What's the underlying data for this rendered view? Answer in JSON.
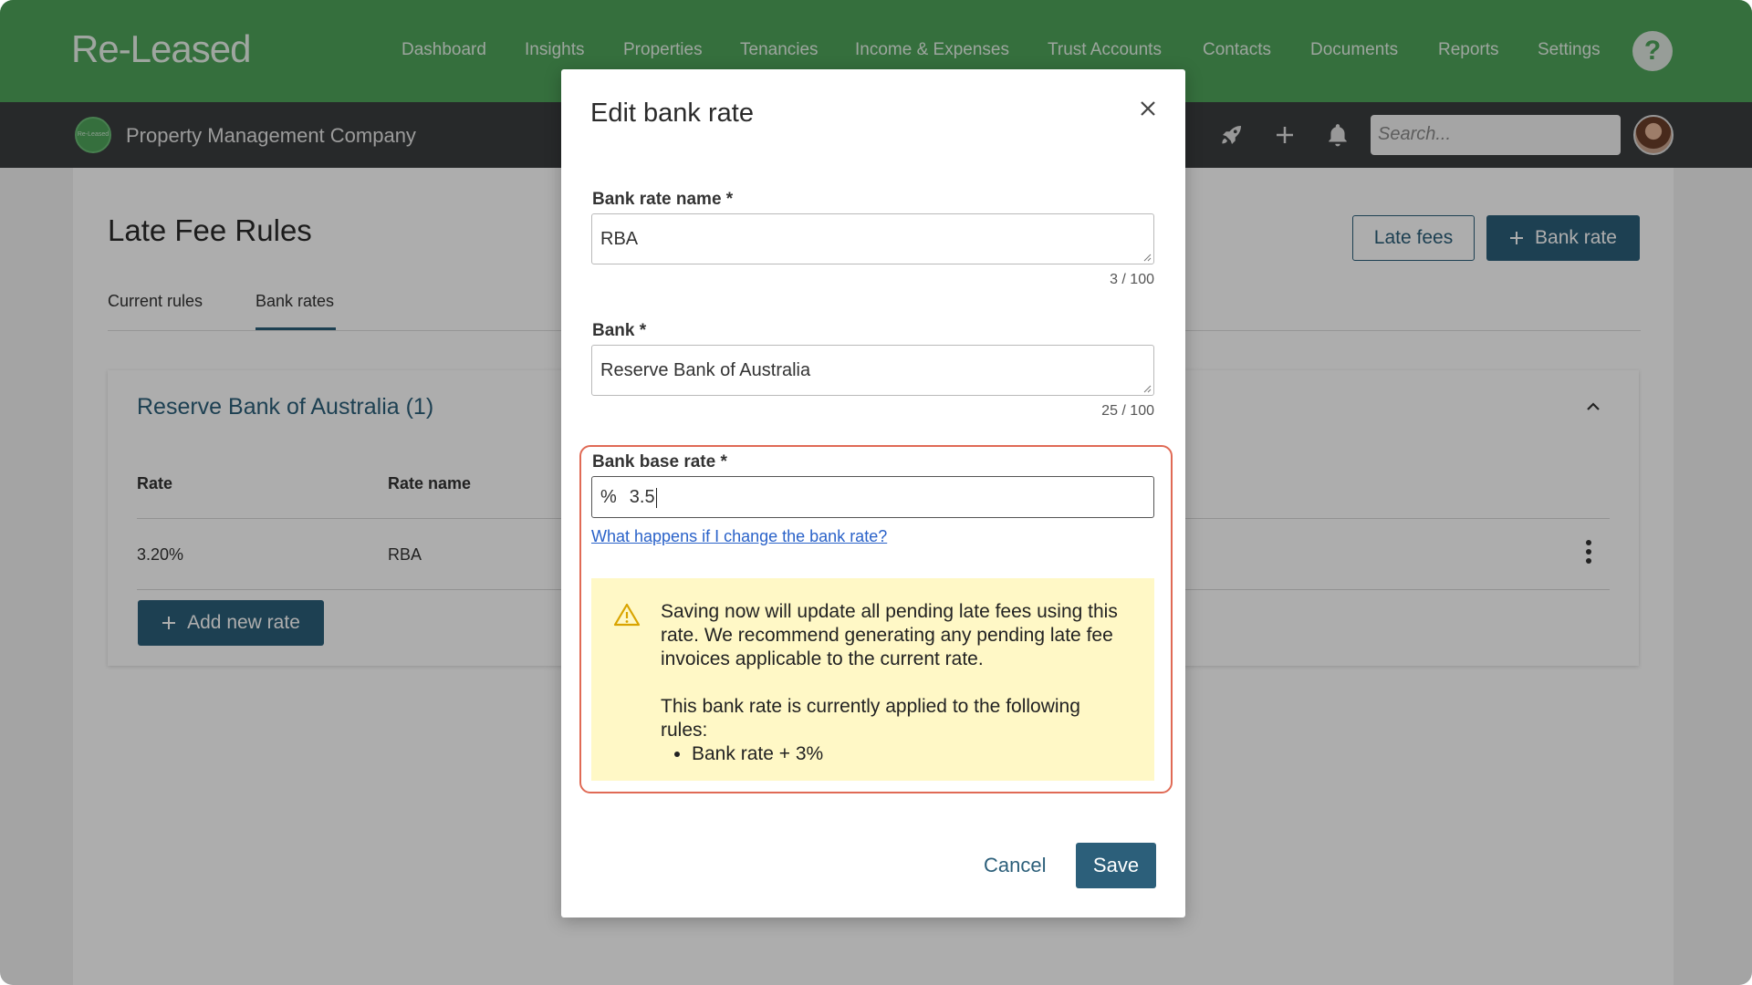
{
  "app": {
    "logo_text": "Re-Leased",
    "company_logo_text": "Re-Leased"
  },
  "nav": {
    "items": [
      "Dashboard",
      "Insights",
      "Properties",
      "Tenancies",
      "Income & Expenses",
      "Trust Accounts",
      "Contacts",
      "Documents",
      "Reports",
      "Settings"
    ],
    "help_label": "?"
  },
  "subbar": {
    "company_name": "Property Management Company",
    "search_placeholder": "Search..."
  },
  "page": {
    "title": "Late Fee Rules",
    "tabs": [
      "Current rules",
      "Bank rates"
    ],
    "active_tab": "Bank rates",
    "late_fees_button": "Late fees",
    "bank_rate_button": "Bank rate",
    "card": {
      "title": "Reserve Bank of Australia (1)",
      "columns": [
        "Rate",
        "Rate name"
      ],
      "rows": [
        {
          "rate": "3.20%",
          "name": "RBA"
        }
      ],
      "add_button": "Add new rate"
    }
  },
  "modal": {
    "title": "Edit bank rate",
    "fields": {
      "name": {
        "label": "Bank rate name *",
        "value": "RBA",
        "counter": "3 / 100"
      },
      "bank": {
        "label": "Bank *",
        "value": "Reserve Bank of Australia",
        "counter": "25 / 100"
      },
      "base_rate": {
        "label": "Bank base rate *",
        "prefix": "%",
        "value": "3.5"
      }
    },
    "help_link": "What happens if I change the bank rate?",
    "warning": {
      "text1": "Saving now will update all pending late fees using this rate. We recommend generating any pending late fee invoices applicable to the current rate.",
      "text2": "This bank rate is currently applied to the following rules:",
      "rules": [
        "Bank rate + 3%"
      ]
    },
    "cancel_label": "Cancel",
    "save_label": "Save"
  },
  "colors": {
    "nav_green": "#4ea45a",
    "primary": "#2c5f7a",
    "warning_bg": "#fff8c6",
    "highlight": "#e06a55",
    "link": "#2a62c9"
  }
}
